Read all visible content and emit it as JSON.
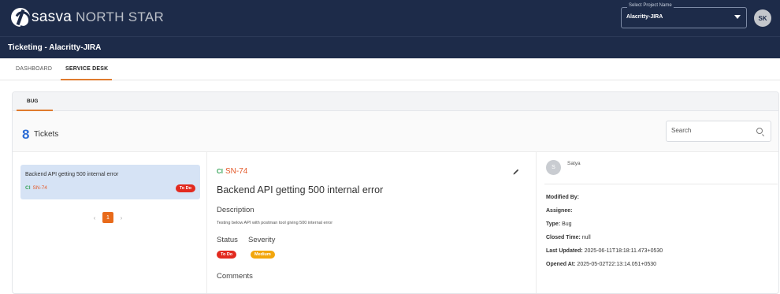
{
  "header": {
    "brand_name": "sasva",
    "brand_suffix": "NORTH STAR",
    "project_select_label": "Select Project Name",
    "project_select_value": "Alacritty-JIRA",
    "user_initials": "SK",
    "bg_color": "#1d2b49"
  },
  "subheader": {
    "title": "Ticketing - Alacritty-JIRA"
  },
  "nav": {
    "tabs": [
      {
        "label": "DASHBOARD",
        "active": false
      },
      {
        "label": "SERVICE DESK",
        "active": true
      }
    ],
    "accent_color": "#e07b2e"
  },
  "category_tabs": [
    {
      "label": "BUG",
      "active": true
    }
  ],
  "tickets": {
    "count": "8",
    "count_label": "Tickets",
    "search_placeholder": "Search",
    "list": [
      {
        "title": "Backend API getting 500 internal error",
        "type_icon": "CI",
        "id": "SN-74",
        "status": "To Do",
        "selected": true
      }
    ],
    "pagination": {
      "prev": "‹",
      "current": "1",
      "next": "›"
    }
  },
  "detail": {
    "type_icon": "CI",
    "id": "SN-74",
    "title": "Backend API getting 500 internal error",
    "description_heading": "Description",
    "description": "Testing below API with postman tool giving 500 internal error",
    "status_heading": "Status",
    "severity_heading": "Severity",
    "status": "To Do",
    "severity": "Medium",
    "comments_heading": "Comments"
  },
  "info": {
    "avatar_initial": "S",
    "user": "Satya",
    "fields": [
      {
        "label": "Modified By:",
        "value": ""
      },
      {
        "label": "Assignee:",
        "value": ""
      },
      {
        "label": "Type:",
        "value": "Bug"
      },
      {
        "label": "Closed Time:",
        "value": "null"
      },
      {
        "label": "Last Updated:",
        "value": "2025-06-11T18:18:11.473+0530"
      },
      {
        "label": "Opened At:",
        "value": "2025-05-02T22:13:14.051+0530"
      }
    ]
  },
  "colors": {
    "status_todo": "#e22a1f",
    "severity_medium": "#f2a60c",
    "ticket_id": "#e45a2a",
    "count": "#2e6ed6",
    "selected_card": "#d6e3f5"
  }
}
